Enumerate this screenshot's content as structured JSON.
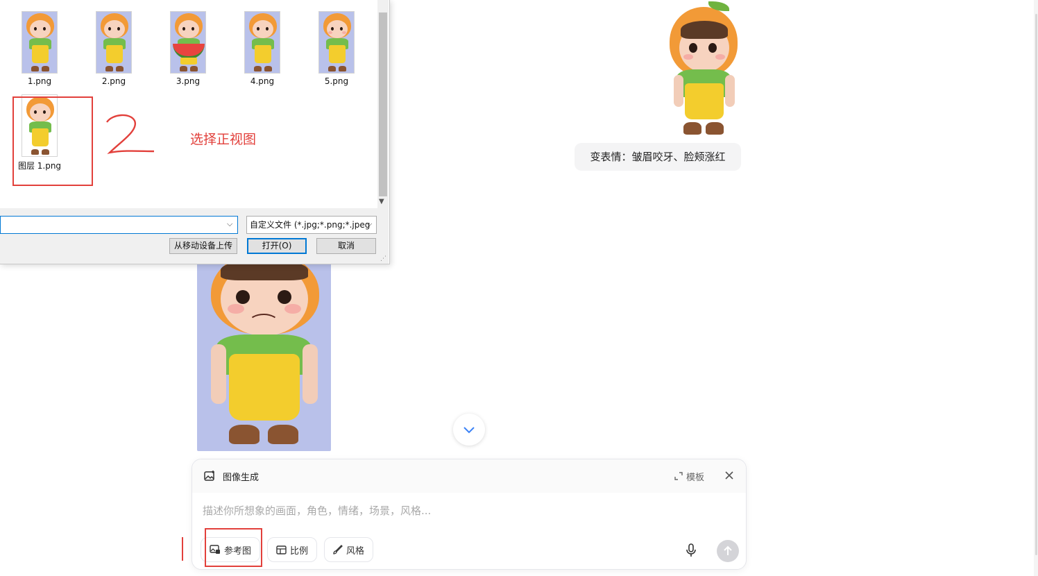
{
  "dialog": {
    "files": [
      {
        "name": "1.png",
        "thumb": "char-hand-face"
      },
      {
        "name": "2.png",
        "thumb": "char-heart-hands"
      },
      {
        "name": "3.png",
        "thumb": "char-watermelon"
      },
      {
        "name": "4.png",
        "thumb": "char-surprised"
      },
      {
        "name": "5.png",
        "thumb": "char-angry"
      },
      {
        "name": "图层 1.png",
        "thumb": "char-front-view"
      }
    ],
    "filter_label": "自定义文件 (*.jpg;*.png;*.jpeg",
    "upload_from_mobile_label": "从移动设备上传",
    "open_label": "打开(O)",
    "cancel_label": "取消"
  },
  "annotations": {
    "step_number": "2",
    "select_front_view": "选择正视图"
  },
  "chat": {
    "user_message": "变表情：皱眉咬牙、脸颊涨红"
  },
  "composer": {
    "title": "图像生成",
    "template_label": "模板",
    "prompt_placeholder": "描述你所想象的画面，角色，情绪，场景，风格...",
    "tools": [
      {
        "label": "参考图",
        "icon": "reference-image-icon"
      },
      {
        "label": "比例",
        "icon": "aspect-ratio-icon"
      },
      {
        "label": "风格",
        "icon": "brush-icon"
      }
    ]
  },
  "colors": {
    "annotation_red": "#e2403b",
    "dialog_accent": "#0078d4",
    "bubble_bg": "#f4f4f5"
  }
}
